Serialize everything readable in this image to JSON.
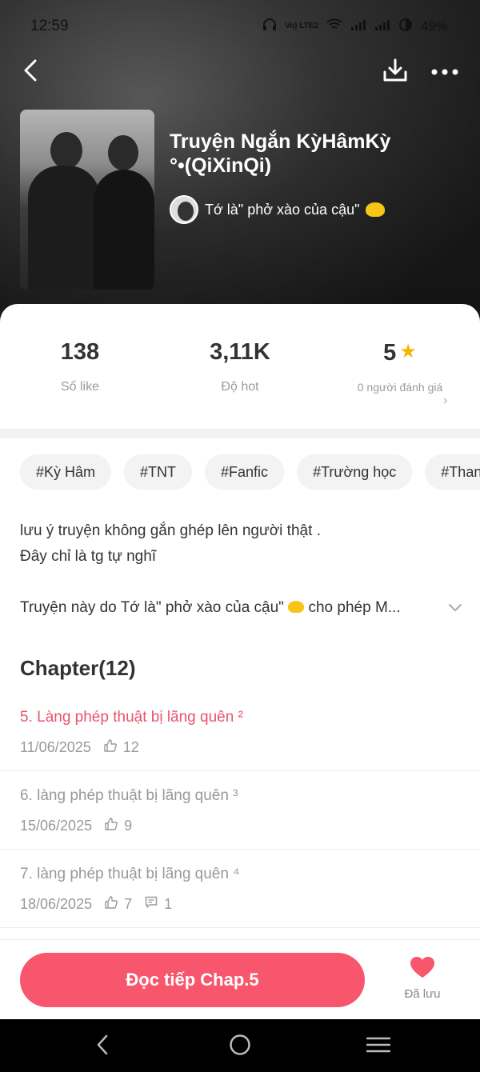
{
  "status_bar": {
    "time": "12:59",
    "network": "Vo) LTE2",
    "battery": "49%"
  },
  "story": {
    "title": "Truyện Ngắn KỳHâmKỳ °•(QiXinQi)",
    "author": "Tớ là\" phở xào của cậu\""
  },
  "stats": {
    "likes_value": "138",
    "likes_label": "Số like",
    "hot_value": "3,11K",
    "hot_label": "Độ hot",
    "rating_value": "5",
    "rating_label": "0 người đánh giá"
  },
  "tags": [
    "#Kỳ Hâm",
    "#TNT",
    "#Fanfic",
    "#Trường học",
    "#Thanh"
  ],
  "description": {
    "line1": "lưu ý truyện không gắn ghép lên người thật .",
    "line2": "Đây chỉ là tg tự nghĩ",
    "line3_prefix": "Truyện này do Tớ là\" phở xào của cậu\"",
    "line3_suffix": "cho phép M..."
  },
  "chapters": {
    "heading": "Chapter(12)",
    "items": [
      {
        "title": "5. Làng phép thuật bị lãng quên ²",
        "date": "11/06/2025",
        "likes": "12",
        "comments": null
      },
      {
        "title": "6. làng phép thuật bị lãng quên ³",
        "date": "15/06/2025",
        "likes": "9",
        "comments": null
      },
      {
        "title": "7. làng phép thuật bị lãng quên ⁴",
        "date": "18/06/2025",
        "likes": "7",
        "comments": "1"
      }
    ]
  },
  "actions": {
    "read_label": "Đọc tiếp Chap.5",
    "saved_label": "Đã lưu"
  },
  "colors": {
    "accent": "#f7566c",
    "active_chapter": "#e8546b",
    "star": "#f5b500"
  },
  "icons": {
    "back": "chevron-left-icon",
    "download": "download-icon",
    "more": "more-dots-icon",
    "heart": "heart-icon",
    "like": "thumbs-up-icon",
    "comment": "comment-icon"
  }
}
